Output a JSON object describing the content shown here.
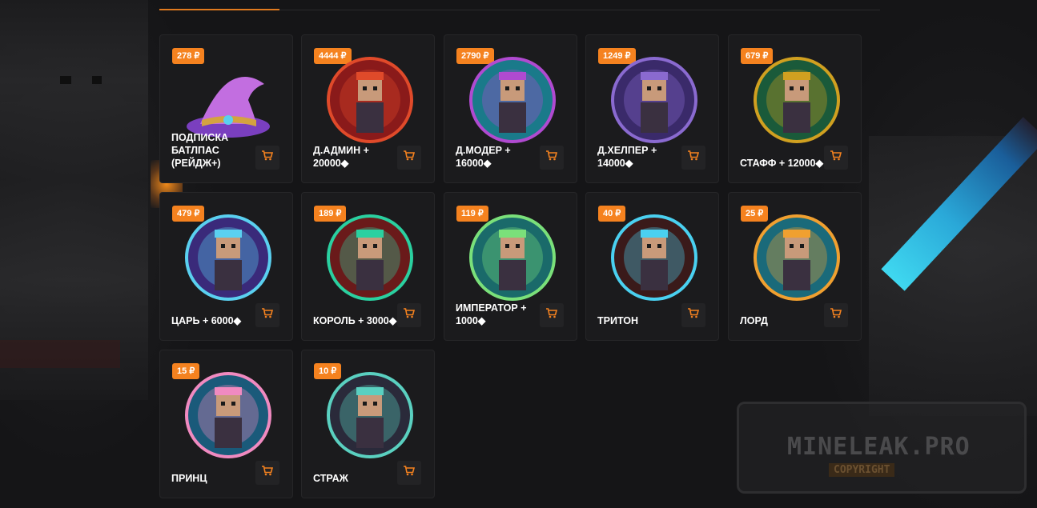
{
  "products": [
    {
      "price": "278 ₽",
      "name": "ПОДПИСКА БАТЛПАС (РЕЙДЖ+)",
      "icon": "wizard-hat-icon",
      "color1": "#7a3fbf",
      "color2": "#c26ee0"
    },
    {
      "price": "4444 ₽",
      "name": "Д.АДМИН + 20000◆",
      "icon": "admin-avatar-icon",
      "color1": "#8a1a1a",
      "color2": "#e04a2a"
    },
    {
      "price": "2790 ₽",
      "name": "Д.МОДЕР + 16000◆",
      "icon": "moder-avatar-icon",
      "color1": "#1a7a8a",
      "color2": "#b04ad0"
    },
    {
      "price": "1249 ₽",
      "name": "Д.ХЕЛПЕР + 14000◆",
      "icon": "helper-avatar-icon",
      "color1": "#3a2a6a",
      "color2": "#8a6ad0"
    },
    {
      "price": "679 ₽",
      "name": "СТАФФ + 12000◆",
      "icon": "staff-avatar-icon",
      "color1": "#1a5a3a",
      "color2": "#d0a020"
    },
    {
      "price": "479 ₽",
      "name": "ЦАРЬ + 6000◆",
      "icon": "tsar-avatar-icon",
      "color1": "#3a2a7a",
      "color2": "#5ad0f0"
    },
    {
      "price": "189 ₽",
      "name": "КОРОЛЬ + 3000◆",
      "icon": "king-avatar-icon",
      "color1": "#6a1a1a",
      "color2": "#2ad0a0"
    },
    {
      "price": "119 ₽",
      "name": "ИМПЕРАТОР + 1000◆",
      "icon": "emperor-avatar-icon",
      "color1": "#1a6a6a",
      "color2": "#7ae07a"
    },
    {
      "price": "40 ₽",
      "name": "ТРИТОН",
      "icon": "triton-avatar-icon",
      "color1": "#3a1a1a",
      "color2": "#4ad0f0"
    },
    {
      "price": "25 ₽",
      "name": "ЛОРД",
      "icon": "lord-avatar-icon",
      "color1": "#1a6a7a",
      "color2": "#f0a030"
    },
    {
      "price": "15 ₽",
      "name": "ПРИНЦ",
      "icon": "prince-avatar-icon",
      "color1": "#1a5a7a",
      "color2": "#f08ac0"
    },
    {
      "price": "10 ₽",
      "name": "СТРАЖ",
      "icon": "guard-avatar-icon",
      "color1": "#2a2a3a",
      "color2": "#5ad0c0"
    }
  ],
  "watermark": {
    "title": "MINELEAK.PRO",
    "subtitle": "COPYRIGHT"
  },
  "colors": {
    "accent": "#f5821f",
    "card_bg": "#1b1b1d",
    "page_bg": "#151517"
  }
}
